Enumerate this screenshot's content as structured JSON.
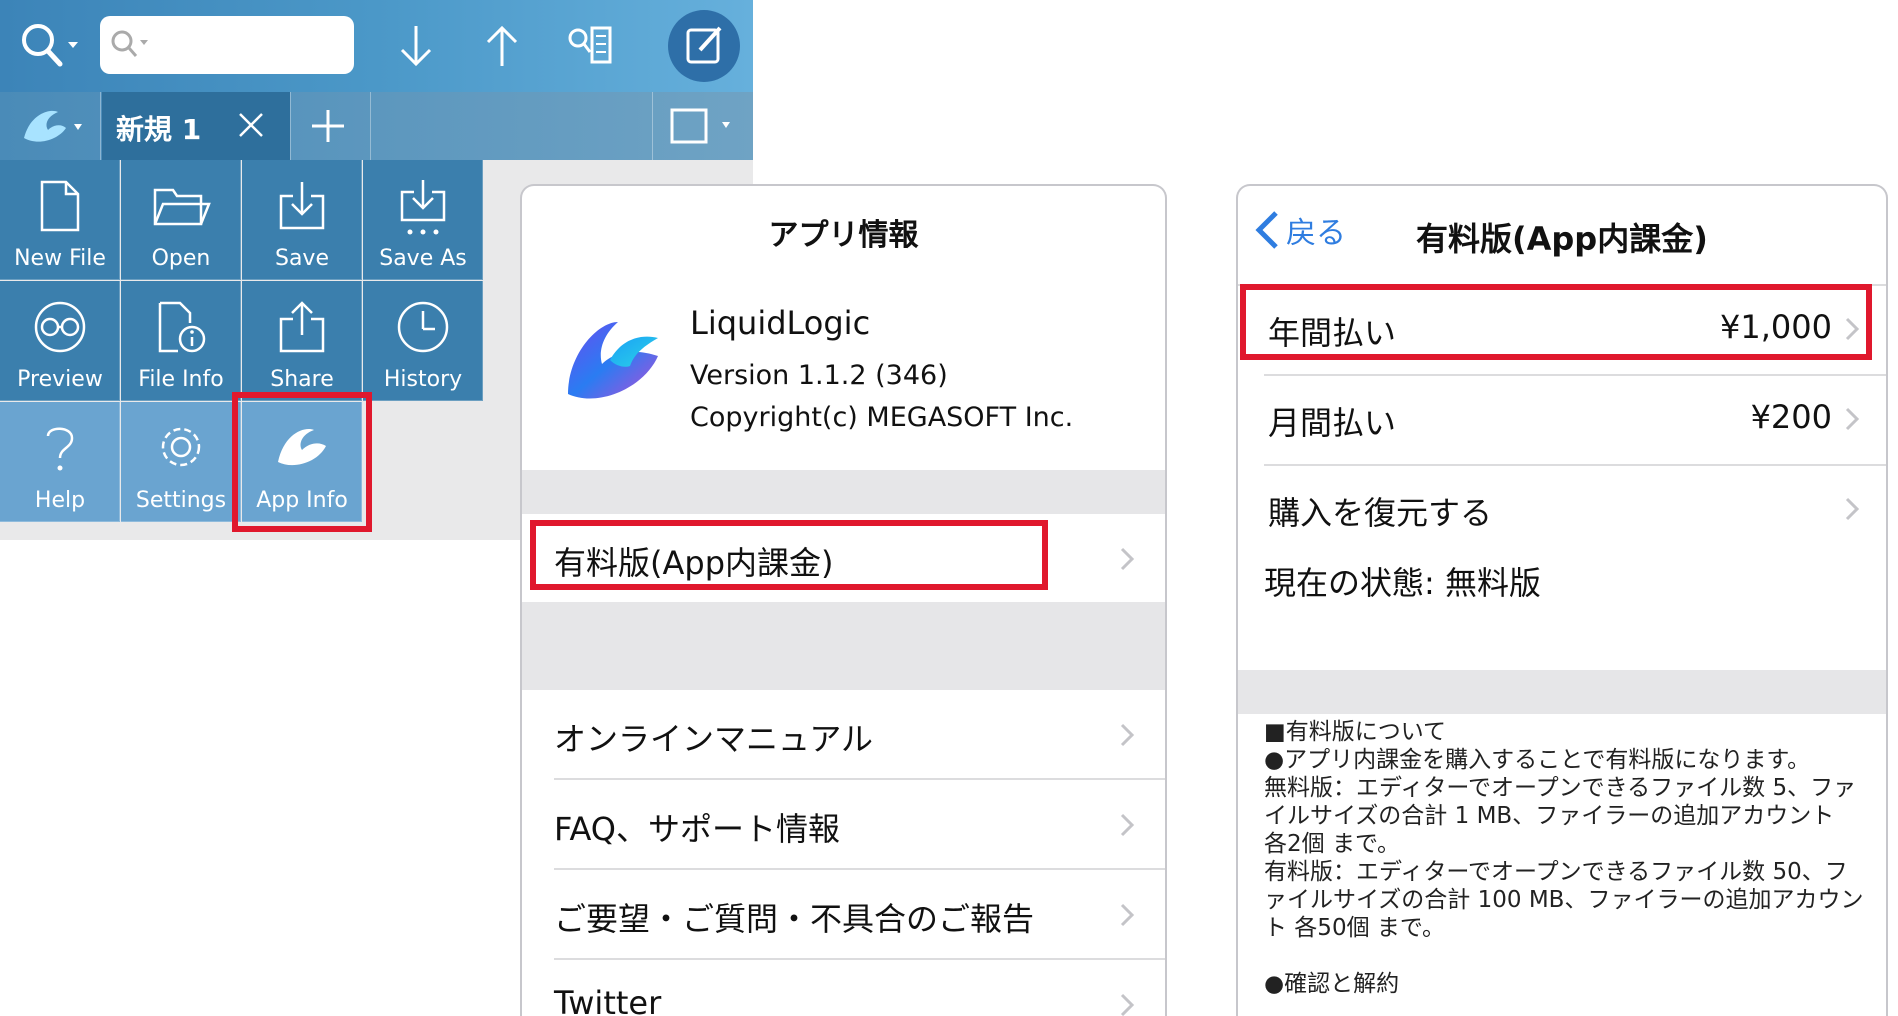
{
  "toolbar": {
    "icons": [
      "search-icon",
      "down-arrow-icon",
      "up-arrow-icon",
      "find-list-icon",
      "compose-icon"
    ]
  },
  "tabbar": {
    "tab_label": "新規 1"
  },
  "menu": {
    "items": [
      {
        "label": "New File",
        "icon": "new-file-icon"
      },
      {
        "label": "Open",
        "icon": "folder-icon"
      },
      {
        "label": "Save",
        "icon": "save-icon"
      },
      {
        "label": "Save As",
        "icon": "save-as-icon"
      },
      {
        "label": "Preview",
        "icon": "glasses-icon"
      },
      {
        "label": "File Info",
        "icon": "file-info-icon"
      },
      {
        "label": "Share",
        "icon": "share-icon"
      },
      {
        "label": "History",
        "icon": "clock-icon"
      },
      {
        "label": "Help",
        "icon": "question-icon"
      },
      {
        "label": "Settings",
        "icon": "gear-icon"
      },
      {
        "label": "App Info",
        "icon": "app-logo-icon"
      }
    ]
  },
  "info": {
    "title": "アプリ情報",
    "app_name": "LiquidLogic",
    "version": "Version 1.1.2 (346)",
    "copyright": "Copyright(c) MEGASOFT Inc.",
    "rows": [
      "有料版(App内課金)",
      "オンラインマニュアル",
      "FAQ、サポート情報",
      "ご要望・ご質問・不具合のご報告",
      "Twitter"
    ]
  },
  "iap": {
    "back_label": "戻る",
    "title": "有料版(App内課金)",
    "rows": [
      {
        "label": "年間払い",
        "price": "¥1,000"
      },
      {
        "label": "月間払い",
        "price": "¥200"
      },
      {
        "label": "購入を復元する",
        "price": ""
      }
    ],
    "status": "現在の状態: 無料版",
    "notes": "■有料版について\n●アプリ内課金を購入することで有料版になります。\n無料版：エディターでオープンできるファイル数 5、ファイルサイズの合計 1 MB、ファイラーの追加アカウント 各2個 まで。\n有料版：エディターでオープンできるファイル数 50、ファイルサイズの合計 100 MB、ファイラーの追加アカウント 各50個 まで。\n\n●確認と解約"
  },
  "colors": {
    "highlight": "#e0182d",
    "link": "#2f7de0",
    "toolbar": "#4b98c8"
  }
}
